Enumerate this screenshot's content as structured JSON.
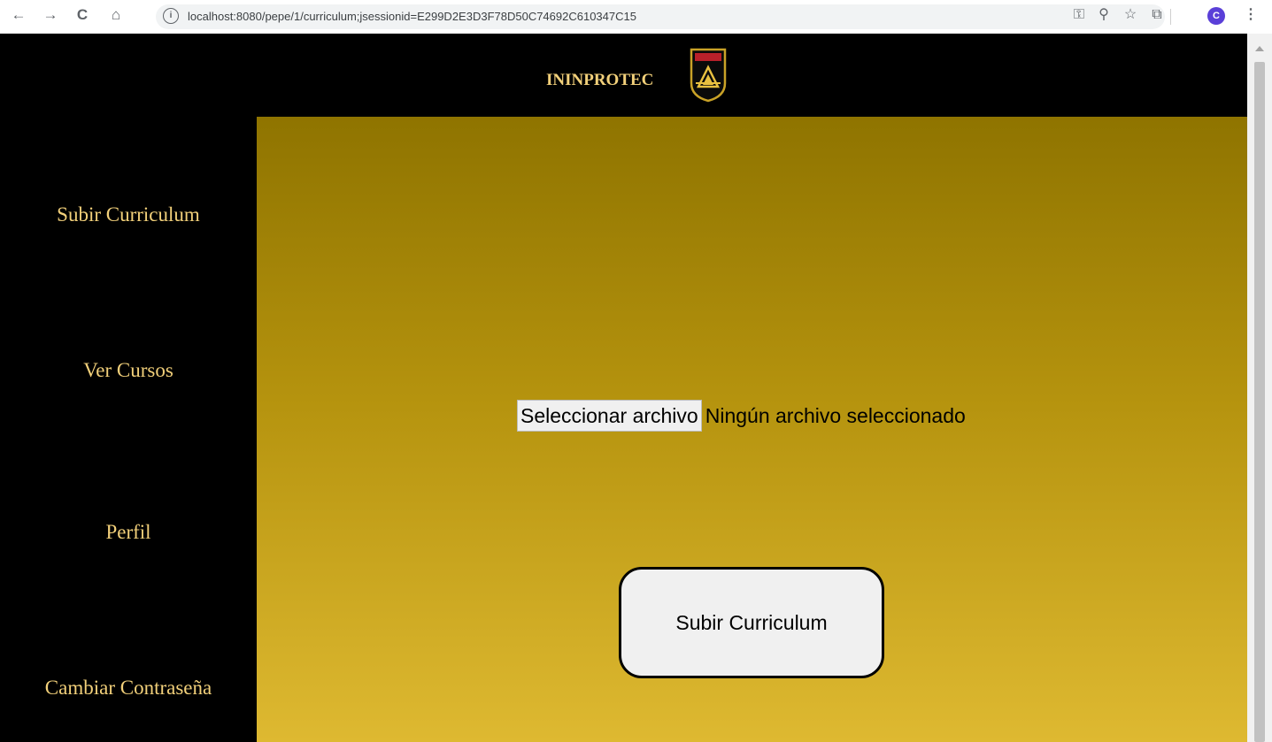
{
  "browser": {
    "url": "localhost:8080/pepe/1/curriculum;jsessionid=E299D2E3D3F78D50C74692C610347C15",
    "back_icon": "←",
    "forward_icon": "→",
    "reload_icon": "C",
    "home_icon": "⌂",
    "info_icon": "ⓘ",
    "key_icon": "⚿",
    "zoom_icon": "⚲",
    "star_icon": "☆",
    "extension_icon": "⧉",
    "avatar_letter": "C",
    "menu_icon": "⋮"
  },
  "header": {
    "brand": "ININPROTEC",
    "logo_text": "",
    "accent_color": "#f2d07a"
  },
  "sidebar": {
    "items": [
      {
        "label": "Subir Curriculum"
      },
      {
        "label": "Ver Cursos"
      },
      {
        "label": "Perfil"
      },
      {
        "label": "Cambiar Contraseña"
      }
    ]
  },
  "main": {
    "file_input": {
      "button_label": "Seleccionar archivo",
      "status": "Ningún archivo seleccionado"
    },
    "submit_label": "Subir Curriculum"
  }
}
